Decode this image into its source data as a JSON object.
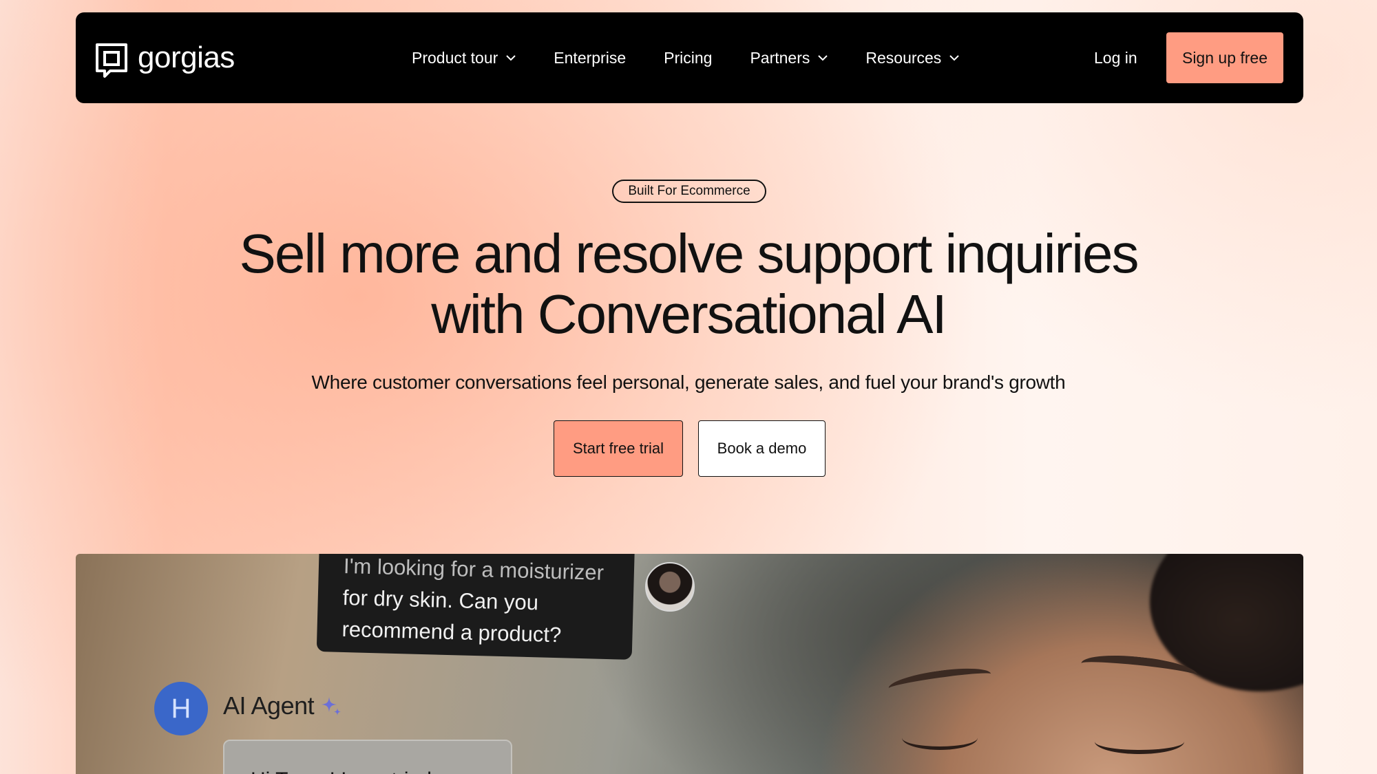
{
  "nav": {
    "logo_text": "gorgias",
    "logo_icon": "gorgias-logo-icon",
    "items": [
      {
        "label": "Product tour",
        "has_dropdown": true
      },
      {
        "label": "Enterprise",
        "has_dropdown": false
      },
      {
        "label": "Pricing",
        "has_dropdown": false
      },
      {
        "label": "Partners",
        "has_dropdown": true
      },
      {
        "label": "Resources",
        "has_dropdown": true
      }
    ],
    "login_label": "Log in",
    "signup_label": "Sign up free"
  },
  "hero": {
    "badge": "Built For Ecommerce",
    "headline_line1": "Sell more and resolve support inquiries",
    "headline_line2": "with Conversational AI",
    "subhead": "Where customer conversations feel personal, generate sales, and fuel your brand's growth",
    "primary_cta": "Start free trial",
    "secondary_cta": "Book a demo"
  },
  "media": {
    "customer_message_partial": "I'm looking for a moisturizer",
    "customer_message_line2": "for dry skin. Can you",
    "customer_message_line3": "recommend a product?",
    "agent_initial": "H",
    "agent_name": "AI Agent",
    "agent_reply_partial": "Hi Tessa! I can tried"
  },
  "colors": {
    "accent": "#ff9c82",
    "nav_bg": "#000000",
    "agent_avatar": "#3a67c9"
  }
}
